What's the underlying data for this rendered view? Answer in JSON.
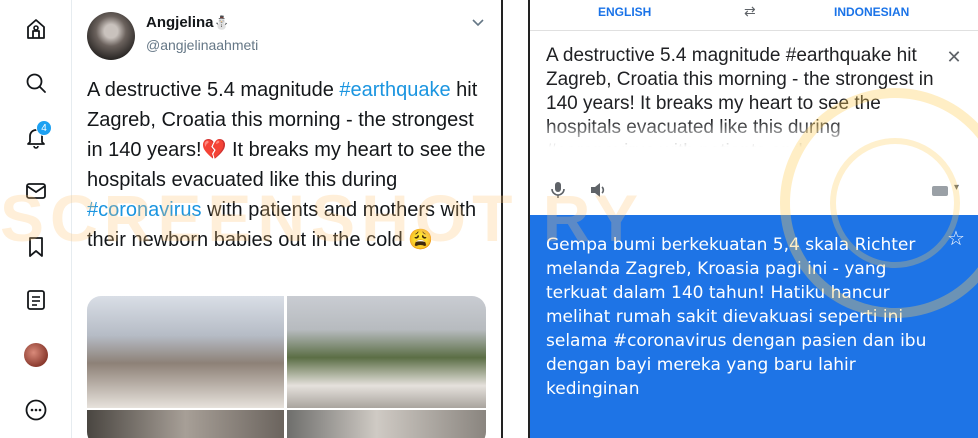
{
  "twitter": {
    "nav": [
      "home-icon",
      "explore-icon",
      "notifications-icon",
      "messages-icon",
      "bookmarks-icon",
      "lists-icon",
      "profile-avatar",
      "more-icon"
    ],
    "notification_count": "4",
    "tweet": {
      "name": "Angjelina",
      "name_emoji": "⛄",
      "handle": "@angjelinaahmeti",
      "text_parts": {
        "p1": "A destructive 5.4 magnitude ",
        "hashtag1": "#earthquake",
        "p2": " hit Zagreb, Croatia this morning - the strongest in 140 years!",
        "emoji1": "💔",
        "p3": " It breaks my heart to see the hospitals evacuated like this during ",
        "hashtag2": "#coronavirus",
        "p4": " with patients and mothers with their newborn babies out in the cold ",
        "emoji2": "😩"
      }
    }
  },
  "watermark": "SCREENSHOT RY",
  "translate": {
    "source_lang": "ENGLISH",
    "target_lang": "INDONESIAN",
    "swap_symbol": "⇄",
    "source_text": "A destructive 5.4 magnitude #earthquake hit Zagreb, Croatia this morning - the strongest in 140 years! It breaks my heart to see the hospitals evacuated like this during #coronavirus with patients and",
    "clear_symbol": "✕",
    "output_text": "Gempa bumi berkekuatan 5,4 skala Richter melanda Zagreb, Kroasia pagi ini - yang terkuat dalam 140 tahun! Hatiku hancur melihat rumah sakit dievakuasi seperti ini selama #coronavirus dengan pasien dan ibu dengan bayi mereka yang baru lahir kedinginan",
    "star_symbol": "☆",
    "accent_color": "#1e74e6"
  }
}
